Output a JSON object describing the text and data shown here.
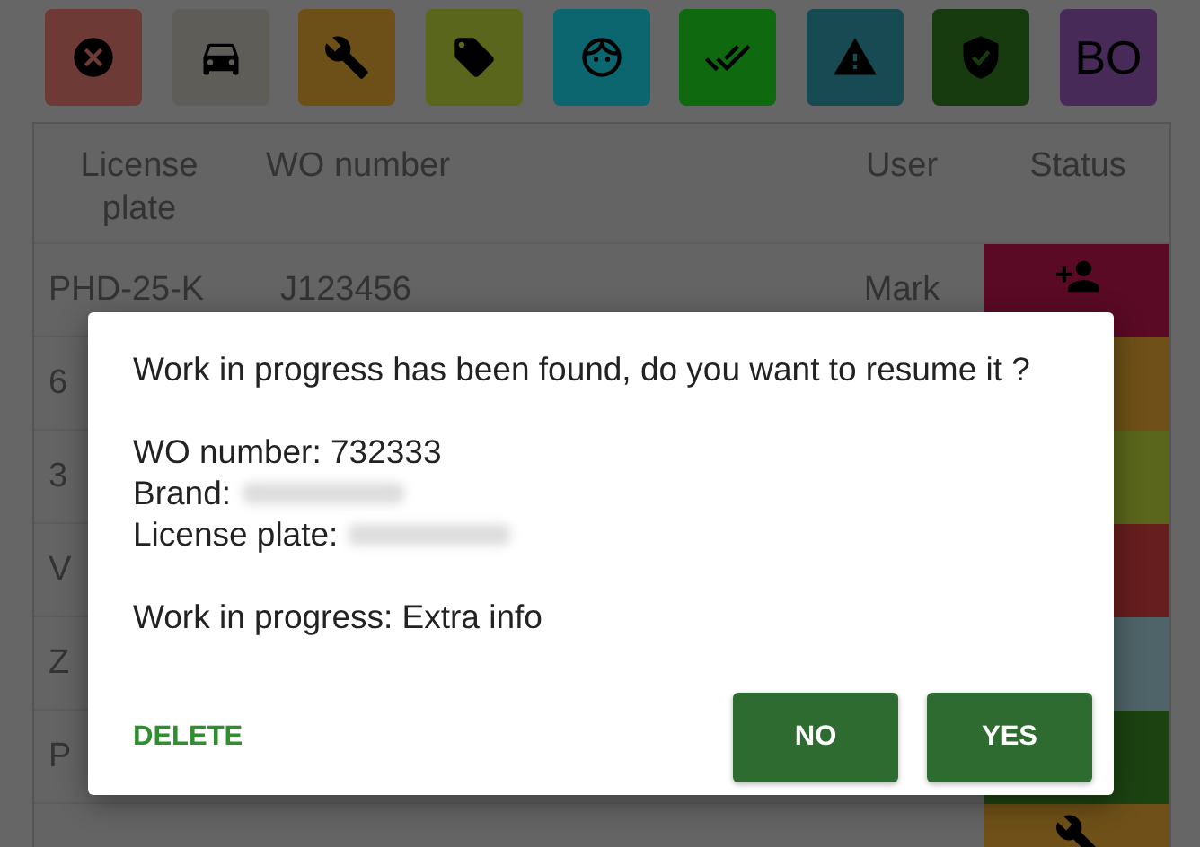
{
  "toolbar": [
    {
      "kind": "cancel",
      "color": "#6e3a36"
    },
    {
      "kind": "car",
      "color": "#5f5d58"
    },
    {
      "kind": "wrench",
      "color": "#6c5018"
    },
    {
      "kind": "tag",
      "color": "#5a661b"
    },
    {
      "kind": "face",
      "color": "#0b6670"
    },
    {
      "kind": "done-all",
      "color": "#0f6a0f"
    },
    {
      "kind": "warning",
      "color": "#174a52"
    },
    {
      "kind": "shield",
      "color": "#173b0f"
    },
    {
      "kind": "text",
      "label": "BO",
      "color": "#472a57"
    }
  ],
  "table": {
    "columns": [
      "License plate",
      "WO number",
      "User",
      "Status"
    ],
    "rows": [
      {
        "cells": [
          "PHD-25-K",
          "J123456",
          "Mark"
        ],
        "status": {
          "kind": "person-add",
          "color": "#5a0a24"
        }
      },
      {
        "cells": [
          "6"
        ],
        "status": {
          "kind": "none",
          "color": "#6e5018"
        }
      },
      {
        "cells": [
          "3"
        ],
        "status": {
          "kind": "none",
          "color": "#5a661b"
        }
      },
      {
        "cells": [
          "V"
        ],
        "status": {
          "kind": "none",
          "color": "#661e1e"
        }
      },
      {
        "cells": [
          "Z"
        ],
        "status": {
          "kind": "none",
          "color": "#4f6468"
        }
      },
      {
        "cells": [
          "P"
        ],
        "status": {
          "kind": "none",
          "color": "#1d4212"
        }
      },
      {
        "cells": [],
        "status": {
          "kind": "wrench",
          "color": "#6e5018"
        }
      }
    ]
  },
  "dialog": {
    "message": "Work in progress has been found, do you want to resume it ?",
    "details": [
      {
        "label": "WO number: 732333",
        "redacted": false
      },
      {
        "label": "Brand:",
        "redacted": true
      },
      {
        "label": "License plate:",
        "redacted": true
      }
    ],
    "note": "Work in progress: Extra info",
    "buttons": [
      {
        "label": "DELETE",
        "kind": "text"
      },
      {
        "label": "NO",
        "kind": "filled"
      },
      {
        "label": "YES",
        "kind": "filled"
      }
    ]
  }
}
